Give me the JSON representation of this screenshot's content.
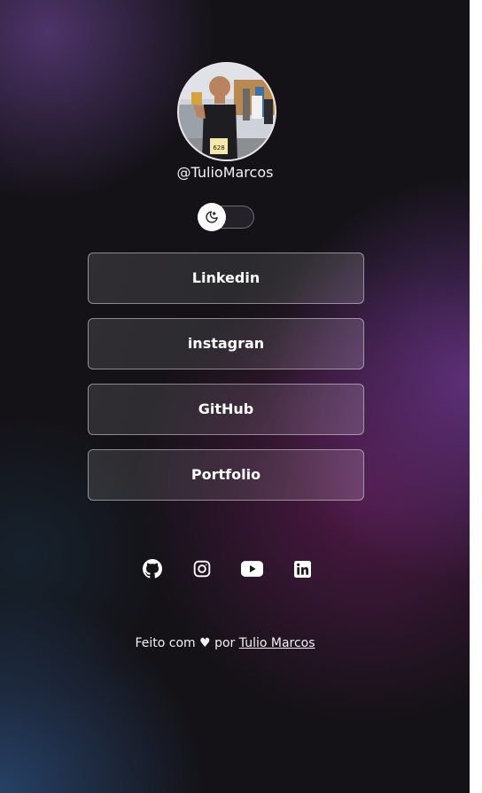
{
  "profile": {
    "username": "@TulioMarcos",
    "avatar_icon": "profile-photo-icon"
  },
  "theme_toggle": {
    "icon": "moon-icon",
    "state": "dark"
  },
  "links": [
    {
      "label": "Linkedin"
    },
    {
      "label": "instagran"
    },
    {
      "label": "GitHub"
    },
    {
      "label": "Portfolio"
    }
  ],
  "socials": [
    {
      "icon": "github-icon"
    },
    {
      "icon": "instagram-icon"
    },
    {
      "icon": "youtube-icon"
    },
    {
      "icon": "linkedin-icon"
    }
  ],
  "footer": {
    "prefix": "Feito com ♥ por ",
    "author": "Tulio Marcos"
  },
  "colors": {
    "background": "#141217",
    "text": "#f2f2f2",
    "accent_purple": "#623280",
    "accent_blue": "#28466e"
  }
}
